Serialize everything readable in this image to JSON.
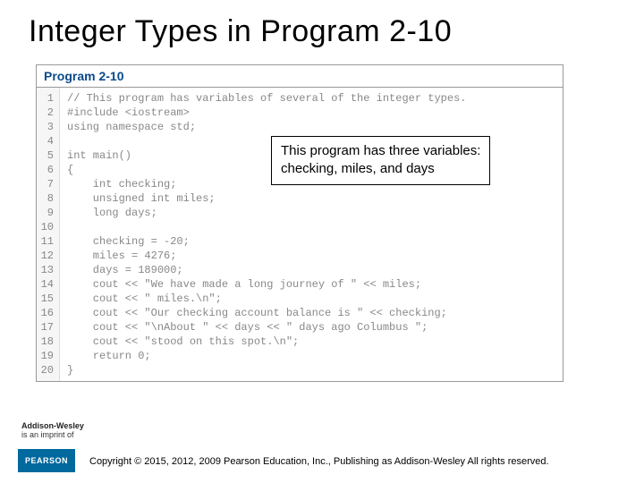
{
  "title": "Integer Types in Program 2-10",
  "program": {
    "label": "Program 2-10",
    "lines": [
      "// This program has variables of several of the integer types.",
      "#include <iostream>",
      "using namespace std;",
      "",
      "int main()",
      "{",
      "    int checking;",
      "    unsigned int miles;",
      "    long days;",
      "",
      "    checking = -20;",
      "    miles = 4276;",
      "    days = 189000;",
      "    cout << \"We have made a long journey of \" << miles;",
      "    cout << \" miles.\\n\";",
      "    cout << \"Our checking account balance is \" << checking;",
      "    cout << \"\\nAbout \" << days << \" days ago Columbus \";",
      "    cout << \"stood on this spot.\\n\";",
      "    return 0;",
      "}"
    ]
  },
  "callout": {
    "line1": "This program has three variables:",
    "line2": "checking, miles, and days"
  },
  "footer": {
    "imprint_brand": "Addison-Wesley",
    "imprint_tag": "is an imprint of",
    "pearson": "PEARSON",
    "copyright": "Copyright © 2015, 2012, 2009 Pearson Education, Inc., Publishing as Addison-Wesley All rights reserved."
  }
}
